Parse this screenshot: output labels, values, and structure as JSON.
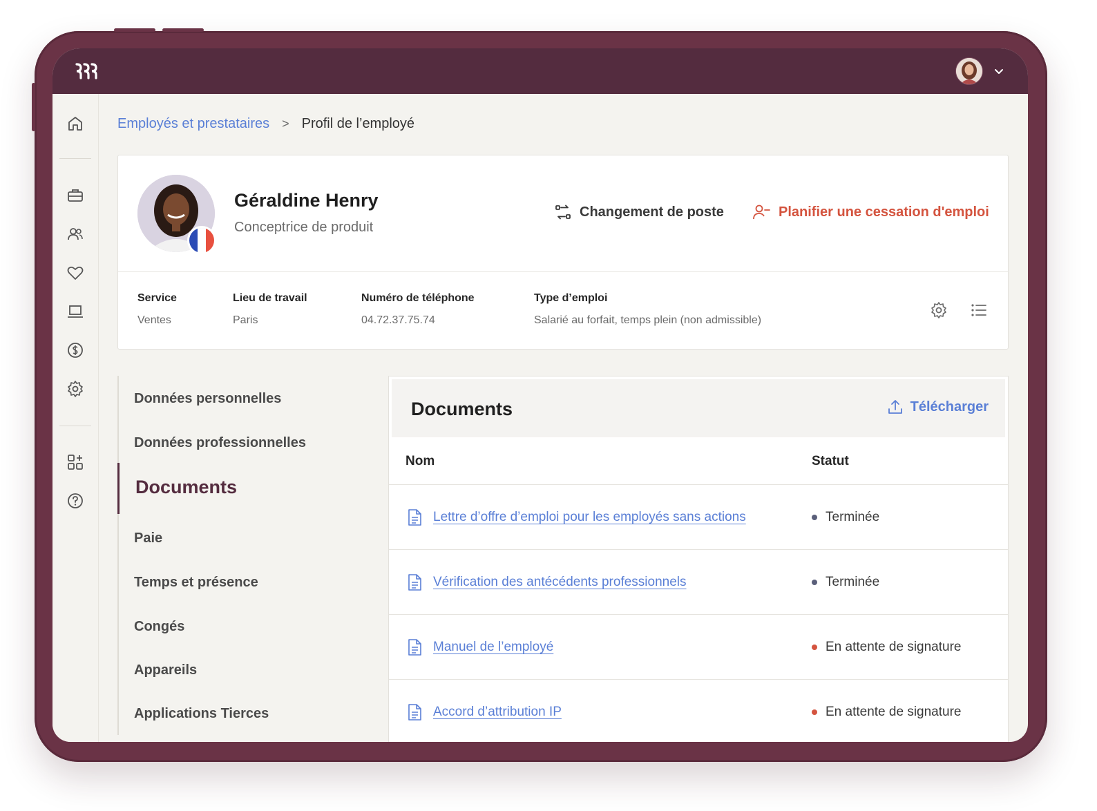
{
  "colors": {
    "frame": "#6a3346",
    "topbar": "#542c3f",
    "link": "#5a7fd6",
    "danger": "#d4543f",
    "status_done": "#5a5f7a",
    "status_pending": "#d4543f"
  },
  "topbar": {
    "logo_icon": "rippling-logo-icon",
    "avatar_icon": "user-avatar",
    "menu_icon": "chevron-down-icon"
  },
  "sidebar": {
    "icons": [
      "home-icon",
      "briefcase-icon",
      "users-icon",
      "heart-icon",
      "laptop-icon",
      "dollar-icon",
      "settings-icon",
      "apps-add-icon",
      "help-icon"
    ]
  },
  "breadcrumb": {
    "parent": "Employés et prestataires",
    "separator": ">",
    "current": "Profil de l’employé"
  },
  "employee": {
    "name": "Géraldine Henry",
    "title": "Conceptrice de produit",
    "flag": "france-flag"
  },
  "actions": {
    "change_role": "Changement de poste",
    "schedule_termination": "Planifier une cessation d'emploi"
  },
  "info": [
    {
      "label": "Service",
      "value": "Ventes"
    },
    {
      "label": "Lieu de travail",
      "value": "Paris"
    },
    {
      "label": "Numéro de téléphone",
      "value": "04.72.37.75.74"
    },
    {
      "label": "Type d’emploi",
      "value": "Salarié au forfait, temps plein (non admissible)"
    }
  ],
  "subnav": {
    "items": [
      "Données personnelles",
      "Données professionnelles",
      "Documents",
      "Paie",
      "Temps et présence",
      "Congés",
      "Appareils",
      "Applications Tierces"
    ],
    "active": "Documents"
  },
  "documents": {
    "title": "Documents",
    "upload_label": "Télécharger",
    "columns": {
      "name": "Nom",
      "status": "Statut"
    },
    "rows": [
      {
        "name": "Lettre d’offre d’emploi pour les employés sans actions",
        "status": "Terminée",
        "state": "done"
      },
      {
        "name": "Vérification des antécédents professionnels",
        "status": "Terminée",
        "state": "done"
      },
      {
        "name": "Manuel de l’employé",
        "status": "En attente de signature",
        "state": "pending"
      },
      {
        "name": "Accord d’attribution IP",
        "status": "En attente de signature",
        "state": "pending"
      }
    ]
  }
}
